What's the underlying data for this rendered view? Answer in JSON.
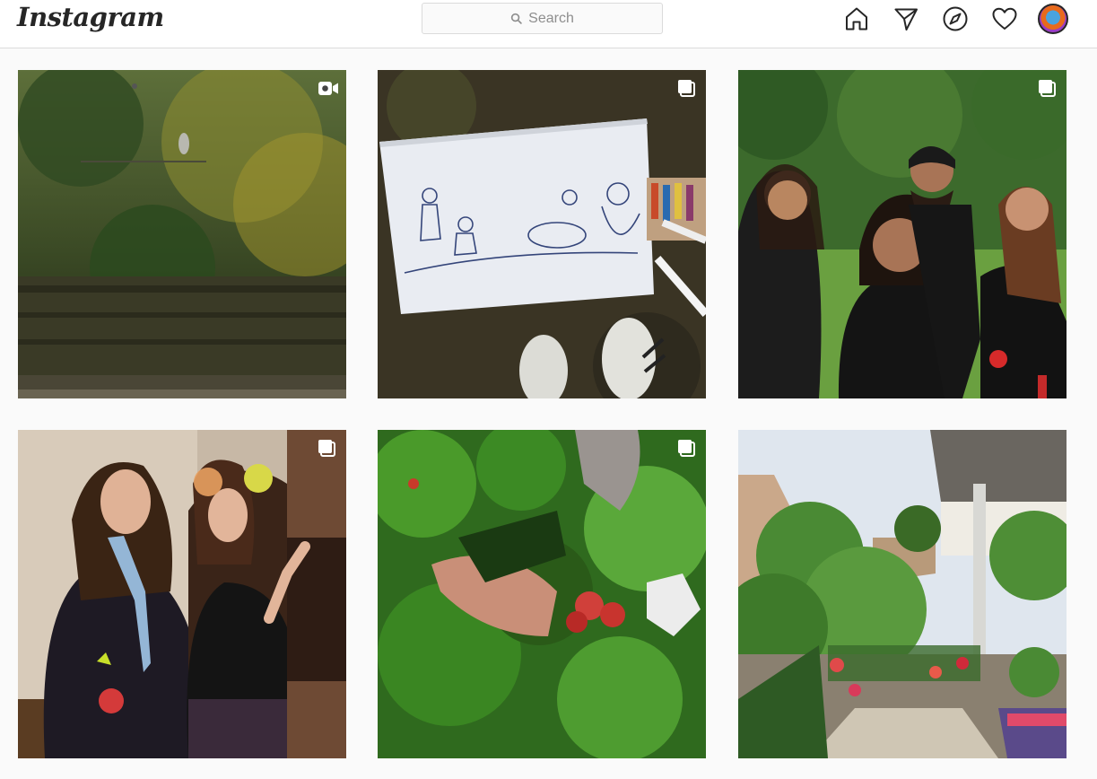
{
  "header": {
    "logo_text": "Instagram",
    "search_placeholder": "Search"
  },
  "icons": {
    "home": "home-icon",
    "direct": "paper-plane-icon",
    "explore": "compass-icon",
    "activity": "heart-icon",
    "profile": "avatar"
  },
  "posts": [
    {
      "subject": "garden-with-heron",
      "badge": "video-icon"
    },
    {
      "subject": "drawing-and-sneakers",
      "badge": "carousel-icon"
    },
    {
      "subject": "four-friends-in-park",
      "badge": "carousel-icon"
    },
    {
      "subject": "juggling-women",
      "badge": "carousel-icon"
    },
    {
      "subject": "picking-tomatoes",
      "badge": "carousel-icon"
    },
    {
      "subject": "terrace-garden",
      "badge": "none"
    }
  ],
  "colors": {
    "background": "#fafafa",
    "header_bg": "#ffffff",
    "border": "#dbdbdb",
    "icon": "#262626"
  }
}
